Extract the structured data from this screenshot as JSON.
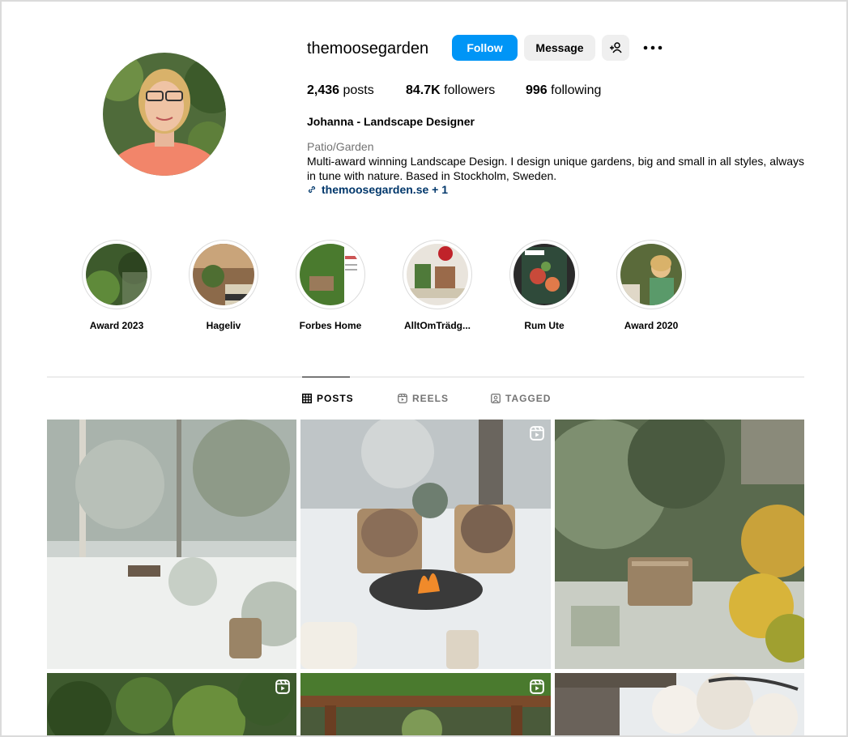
{
  "profile": {
    "username": "themoosegarden",
    "follow_label": "Follow",
    "message_label": "Message",
    "stats": {
      "posts_count": "2,436",
      "posts_label": " posts",
      "followers_count": "84.7K",
      "followers_label": " followers",
      "following_count": "996",
      "following_label": " following"
    },
    "full_name": "Johanna - Landscape Designer",
    "category": "Patio/Garden",
    "bio": "Multi-award winning Landscape Design. I design unique gardens, big and small in all styles, always in tune with nature. Based in Stockholm, Sweden.",
    "link_text": "themoosegarden.se + 1"
  },
  "highlights": [
    {
      "label": "Award 2023"
    },
    {
      "label": "Hageliv"
    },
    {
      "label": "Forbes Home"
    },
    {
      "label": "AlltOmTrädg..."
    },
    {
      "label": "Rum Ute"
    },
    {
      "label": "Award 2020"
    }
  ],
  "tabs": [
    {
      "label": "POSTS",
      "icon": "grid-icon",
      "active": true
    },
    {
      "label": "REELS",
      "icon": "reels-icon",
      "active": false
    },
    {
      "label": "TAGGED",
      "icon": "tagged-icon",
      "active": false
    }
  ],
  "posts": [
    {
      "kind": "snowy-forest-garden",
      "reel": false
    },
    {
      "kind": "snowy-fire-pit-chairs",
      "reel": true
    },
    {
      "kind": "snowy-bench-yellow-leaves",
      "reel": false
    },
    {
      "kind": "green-garden-shrubs",
      "reel": true
    },
    {
      "kind": "moss-roof-pergola",
      "reel": true
    },
    {
      "kind": "blossoming-tree-house",
      "reel": false
    }
  ],
  "colors": {
    "follow_blue": "#0095f6",
    "button_gray": "#efefef",
    "link_blue": "#00376b",
    "muted_text": "#737373",
    "divider": "#dbdbdb"
  }
}
